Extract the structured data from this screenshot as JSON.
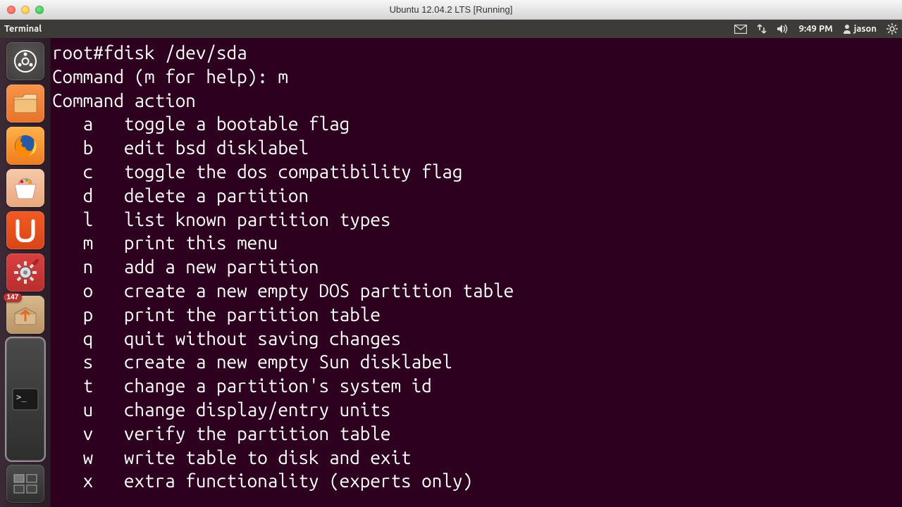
{
  "mac": {
    "title": "Ubuntu 12.04.2 LTS [Running]"
  },
  "menubar": {
    "app_label": "Terminal",
    "time": "9:49 PM",
    "user": "jason"
  },
  "launcher": {
    "dash": "dash",
    "items": [
      {
        "name": "files"
      },
      {
        "name": "firefox"
      },
      {
        "name": "software-center"
      },
      {
        "name": "ubuntu-one"
      },
      {
        "name": "system-settings"
      },
      {
        "name": "software-updater",
        "badge": "147"
      },
      {
        "name": "terminal",
        "active": true
      },
      {
        "name": "workspace-switcher"
      }
    ]
  },
  "terminal": {
    "prompt": "root#fdisk /dev/sda",
    "blank1": "",
    "cmd_line": "Command (m for help): m",
    "action_header": "Command action",
    "actions": [
      {
        "key": "a",
        "desc": "toggle a bootable flag"
      },
      {
        "key": "b",
        "desc": "edit bsd disklabel"
      },
      {
        "key": "c",
        "desc": "toggle the dos compatibility flag"
      },
      {
        "key": "d",
        "desc": "delete a partition"
      },
      {
        "key": "l",
        "desc": "list known partition types"
      },
      {
        "key": "m",
        "desc": "print this menu"
      },
      {
        "key": "n",
        "desc": "add a new partition"
      },
      {
        "key": "o",
        "desc": "create a new empty DOS partition table"
      },
      {
        "key": "p",
        "desc": "print the partition table"
      },
      {
        "key": "q",
        "desc": "quit without saving changes"
      },
      {
        "key": "s",
        "desc": "create a new empty Sun disklabel"
      },
      {
        "key": "t",
        "desc": "change a partition's system id"
      },
      {
        "key": "u",
        "desc": "change display/entry units"
      },
      {
        "key": "v",
        "desc": "verify the partition table"
      },
      {
        "key": "w",
        "desc": "write table to disk and exit"
      },
      {
        "key": "x",
        "desc": "extra functionality (experts only)"
      }
    ]
  }
}
